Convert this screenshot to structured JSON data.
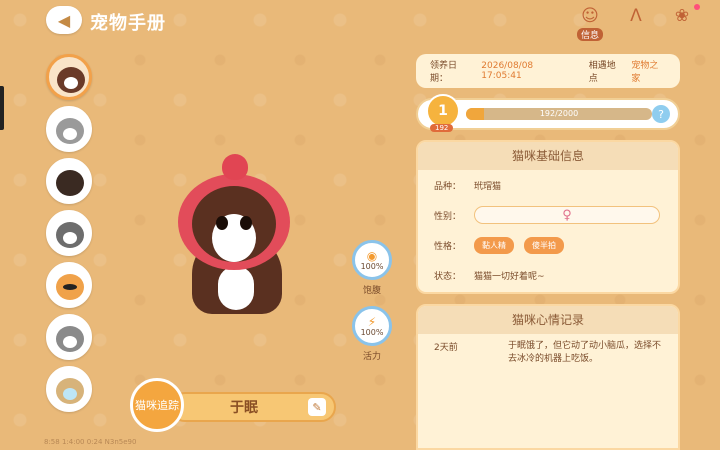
{
  "header": {
    "title": "宠物手册",
    "back_icon": "chevron-left-icon",
    "top_icons": [
      {
        "name": "info",
        "label": "信息"
      },
      {
        "name": "sign",
        "label": ""
      },
      {
        "name": "bow",
        "label": ""
      }
    ]
  },
  "avatars": [
    {
      "name": "cat-brown-strawberry",
      "selected": true
    },
    {
      "name": "cat-gray-tabby",
      "selected": false
    },
    {
      "name": "dog-dark",
      "selected": false
    },
    {
      "name": "cat-gray-white",
      "selected": false
    },
    {
      "name": "cat-orange-sunglasses",
      "selected": false
    },
    {
      "name": "dog-husky",
      "selected": false
    },
    {
      "name": "owl",
      "selected": false
    }
  ],
  "stats": [
    {
      "id": "fullness",
      "label": "饱腹",
      "value": "100%"
    },
    {
      "id": "energy",
      "label": "活力",
      "value": "100%"
    }
  ],
  "tracking": {
    "label": "猫咪追踪"
  },
  "pet_name": "于眠",
  "footer_meta": "8:58  1:4:00  0:24  N3n5e90",
  "adopt": {
    "date_label": "领养日期：",
    "date_value": "2026/08/08 17:05:41",
    "place_label": "相遇地点",
    "place_value": "宠物之家"
  },
  "level": {
    "value": "1",
    "sub": "192",
    "xp_text": "192/2000",
    "xp_current": 192,
    "xp_max": 2000,
    "help": "?"
  },
  "info": {
    "title": "猫咪基础信息",
    "breed_label": "品种：",
    "breed_value": "玳瑁猫",
    "gender_label": "性别：",
    "gender_symbol": "♀",
    "personality_label": "性格：",
    "traits": [
      "黏人精",
      "傻半拍"
    ],
    "status_label": "状态：",
    "status_value": "猫猫一切好着呢~"
  },
  "mood": {
    "title": "猫咪心情记录",
    "entries": [
      {
        "date": "2天前",
        "text": "于眠饿了，但它动了动小脑瓜，选择不去冰冷的机器上吃饭。"
      }
    ]
  }
}
